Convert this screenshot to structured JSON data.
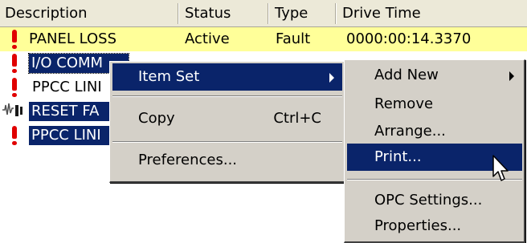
{
  "table": {
    "columns": [
      "Description",
      "Status",
      "Type",
      "Drive Time"
    ],
    "rows": [
      {
        "description": "PANEL LOSS",
        "status": "Active",
        "type": "Fault",
        "drive_time": "0000:00:14.3370"
      },
      {
        "description": "I/O COMM"
      },
      {
        "description": "PPCC LINI"
      },
      {
        "description": "RESET FA"
      },
      {
        "description": "PPCC LINI"
      }
    ]
  },
  "context_menu": {
    "item_set": "Item Set",
    "copy": "Copy",
    "copy_shortcut": "Ctrl+C",
    "preferences": "Preferences..."
  },
  "submenu": {
    "add_new": "Add New",
    "remove": "Remove",
    "arrange": "Arrange...",
    "print": "Print...",
    "opc_settings": "OPC Settings...",
    "properties": "Properties..."
  },
  "colors": {
    "highlight": "#0a246a",
    "alarm_row": "#ffff99",
    "alarm_icon": "#e00000",
    "menu_bg": "#d4d0c8"
  },
  "icons": {
    "alarm": "exclamation-icon",
    "reset": "reset-waveform-icon",
    "submenu": "triangle-right-icon",
    "cursor": "arrow-pointer-icon"
  }
}
